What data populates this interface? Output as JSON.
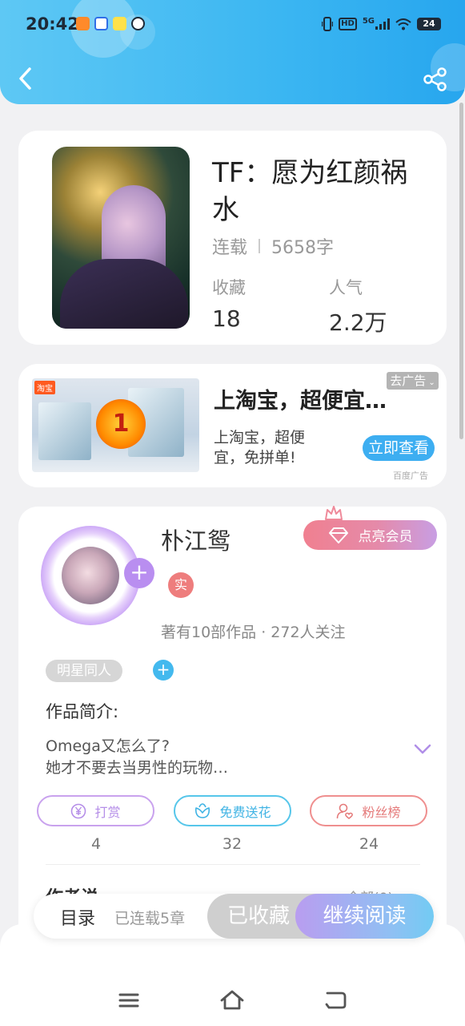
{
  "status_bar": {
    "time": "20:42",
    "network": "5G",
    "hd": "HD",
    "battery": "24"
  },
  "book": {
    "title": "TF：愿为红颜祸水",
    "status": "连载",
    "word_count": "5658字",
    "favorites_label": "收藏",
    "favorites_value": "18",
    "popularity_label": "人气",
    "popularity_value": "2.2万"
  },
  "ad": {
    "title": "上淘宝，超便宜…",
    "description": "上淘宝，超便宜，免拼单!",
    "close_label": "去广告",
    "cta_label": "立即查看",
    "source": "百度广告",
    "image_brand": "淘宝",
    "image_sale": "1"
  },
  "author": {
    "name": "朴江鸳",
    "real_badge": "实",
    "stats": "著有10部作品 · 272人关注",
    "member_button": "点亮会员",
    "tag": "明星同人",
    "intro_label": "作品简介:",
    "intro_line1": "Omega又怎么了?",
    "intro_line2": "她才不要去当男性的玩物…",
    "reward_label": "打赏",
    "reward_count": "4",
    "flower_label": "免费送花",
    "flower_count": "32",
    "fans_label": "粉丝榜",
    "fans_count": "24",
    "more_label": "作者说",
    "more_right": "全部(0)"
  },
  "action_bar": {
    "toc_label": "目录",
    "chapters": "已连载5章",
    "collected_label": "已收藏",
    "continue_label": "继续阅读"
  },
  "colors": {
    "header_blue": "#3bb6f2",
    "accent_purple": "#b98ef0",
    "accent_teal": "#43b9ee",
    "member_pink": "#f08090",
    "reward_border": "#c9a2ee",
    "flower_border": "#56c6ea",
    "fans_border": "#ef8f8f"
  },
  "icons": [
    "back-icon",
    "share-icon",
    "diamond-icon",
    "crown-icon",
    "yen-icon",
    "flower-icon",
    "fans-icon",
    "chevron-down-icon",
    "menu-icon",
    "home-icon",
    "return-icon"
  ]
}
